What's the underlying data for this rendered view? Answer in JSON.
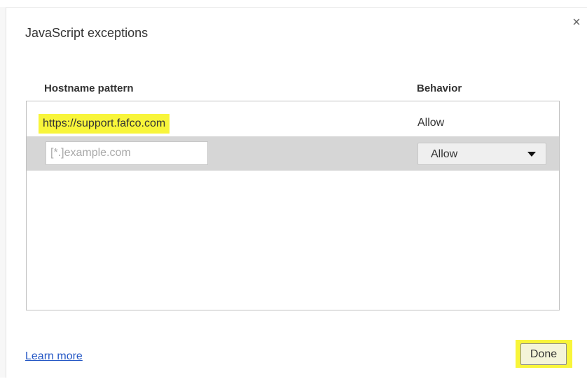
{
  "dialog": {
    "title": "JavaScript exceptions",
    "close_glyph": "×"
  },
  "table": {
    "headers": {
      "hostname": "Hostname pattern",
      "behavior": "Behavior"
    },
    "rows": [
      {
        "hostname": "https://support.fafco.com",
        "behavior": "Allow",
        "highlight_color": "#f8f53a"
      }
    ],
    "new_entry": {
      "placeholder": "[*.]example.com",
      "value": "",
      "behavior_selected": "Allow"
    }
  },
  "footer": {
    "learn_more": "Learn more",
    "done_label": "Done",
    "done_highlight_color": "#f8f53a"
  },
  "colors": {
    "link": "#2457c5",
    "row_selected_bg": "#d6d6d6"
  },
  "icons": {
    "close": "close-icon",
    "dropdown": "chevron-down-icon"
  }
}
